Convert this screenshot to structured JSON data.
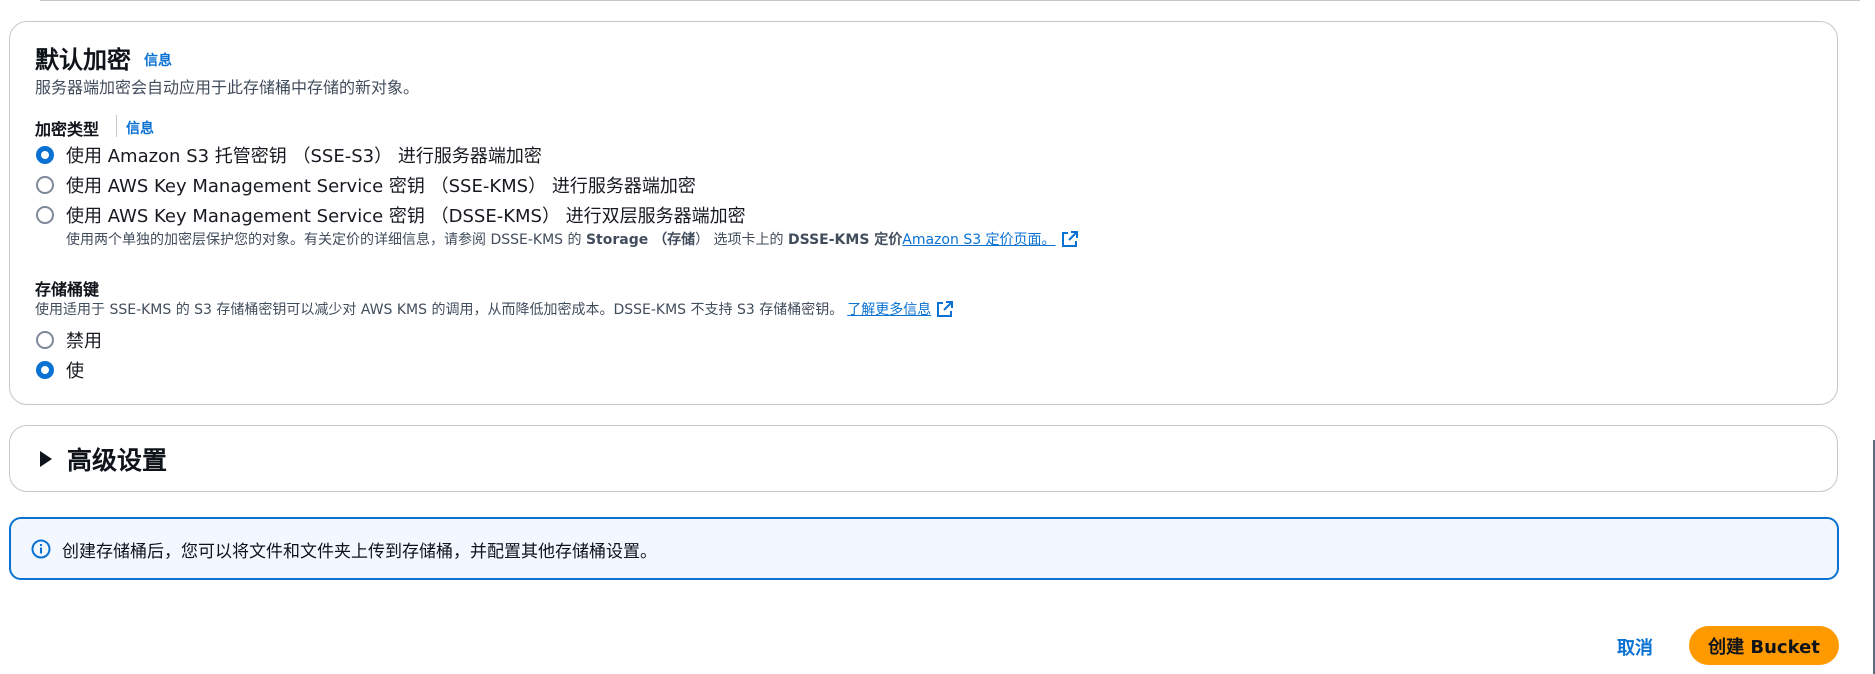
{
  "default_encryption": {
    "title": "默认加密",
    "info_label": "信息",
    "description": "服务器端加密会自动应用于此存储桶中存储的新对象。",
    "encryption_type": {
      "label": "加密类型",
      "info_label": "信息",
      "options": [
        {
          "label": "使用 Amazon S3 托管密钥 （SSE-S3） 进行服务器端加密",
          "selected": true
        },
        {
          "label": "使用 AWS Key Management Service 密钥 （SSE-KMS） 进行服务器端加密",
          "selected": false
        },
        {
          "label": "使用 AWS Key Management Service 密钥 （DSSE-KMS） 进行双层服务器端加密",
          "selected": false
        }
      ],
      "dsse_note": {
        "prefix": "使用两个单独的加密层保护您的对象。有关定价的详细信息，请参阅 DSSE-KMS 的 ",
        "storage_bold": "Storage",
        "paren_storage": " （存储",
        "after_paren": "） 选项卡上的 ",
        "dsse_bold": "DSSE-KMS 定价",
        "link_text": "Amazon S3 定价页面。"
      }
    },
    "bucket_key": {
      "label": "存储桶键",
      "description": "使用适用于 SSE-KMS 的 S3 存储桶密钥可以减少对 AWS KMS 的调用，从而降低加密成本。DSSE-KMS 不支持 S3 存储桶密钥。",
      "learn_more": "了解更多信息",
      "options": [
        {
          "label": "禁用",
          "selected": false
        },
        {
          "label": "使",
          "selected": true
        }
      ]
    }
  },
  "advanced_settings": {
    "title": "高级设置",
    "expanded": false
  },
  "info_alert": {
    "text": "创建存储桶后，您可以将文件和文件夹上传到存储桶，并配置其他存储桶设置。"
  },
  "footer": {
    "cancel_label": "取消",
    "create_label": "创建 Bucket"
  },
  "colors": {
    "link": "#0972d3",
    "primary_button": "#ff9900",
    "alert_border": "#0972d3",
    "alert_bg": "#f2f8fd"
  },
  "icons": [
    "external-link-icon",
    "info-circle-icon",
    "caret-right-icon"
  ]
}
